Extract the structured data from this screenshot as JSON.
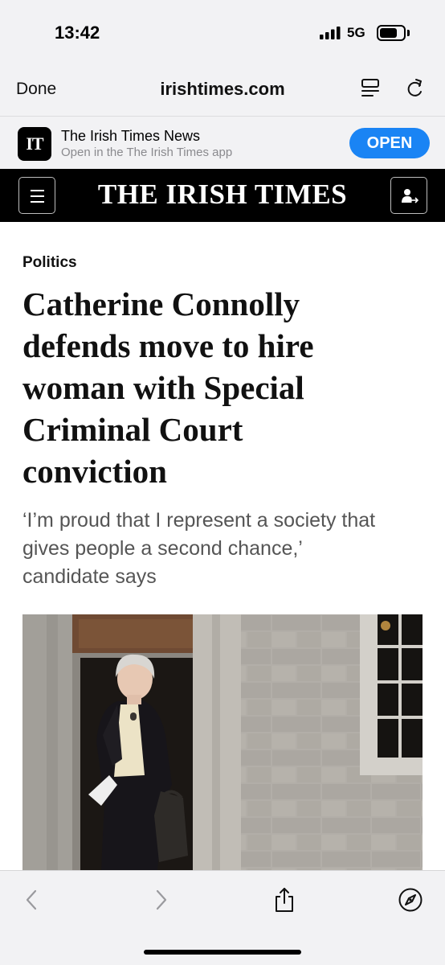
{
  "status_bar": {
    "time": "13:42",
    "network": "5G",
    "battery_level": 0.75
  },
  "browser": {
    "done_label": "Done",
    "url": "irishtimes.com",
    "icons": [
      "reader-view-icon",
      "reload-icon"
    ]
  },
  "app_banner": {
    "logo_text": "IT",
    "title": "The Irish Times News",
    "subtitle": "Open in the The Irish Times app",
    "open_label": "OPEN"
  },
  "site_header": {
    "masthead": "THE IRISH TIMES",
    "icons": [
      "menu-icon",
      "account-icon"
    ]
  },
  "article": {
    "section": "Politics",
    "headline_lines": [
      "Catherine Connolly",
      "defends move to hire",
      "woman with Special",
      "Criminal Court",
      "conviction"
    ],
    "standfirst_lines": [
      "‘I’m proud that I represent a society that",
      "gives people a second chance,’",
      "candidate says"
    ]
  },
  "toolbar": {
    "icons": [
      "back-icon",
      "forward-icon",
      "share-icon",
      "compass-icon"
    ]
  },
  "colors": {
    "chrome_bg": "#f2f2f4",
    "header_bg": "#000000",
    "open_button": "#1a84f4",
    "standfirst": "#555555"
  }
}
